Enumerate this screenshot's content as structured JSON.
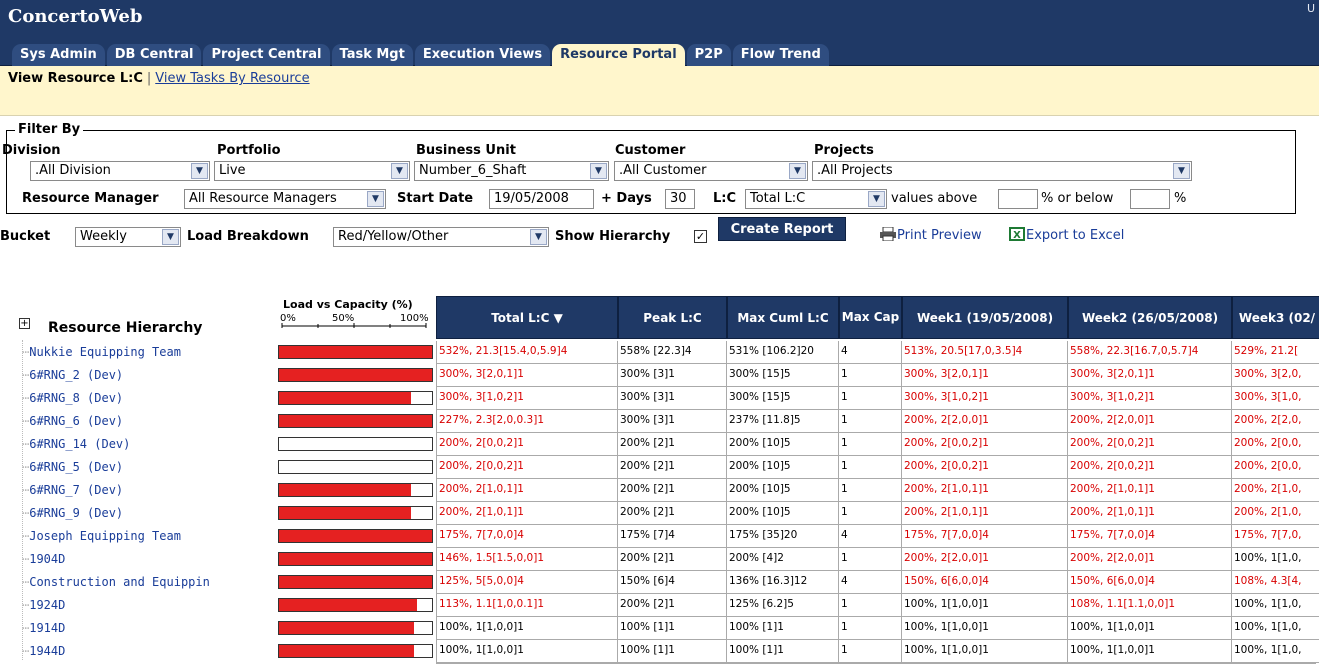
{
  "app": {
    "title": "ConcertoWeb",
    "user_mark": "U"
  },
  "tabs": [
    {
      "label": "Sys Admin",
      "active": false
    },
    {
      "label": "DB Central",
      "active": false
    },
    {
      "label": "Project Central",
      "active": false
    },
    {
      "label": "Task Mgt",
      "active": false
    },
    {
      "label": "Execution Views",
      "active": false
    },
    {
      "label": "Resource Portal",
      "active": true
    },
    {
      "label": "P2P",
      "active": false
    },
    {
      "label": "Flow Trend",
      "active": false
    }
  ],
  "subnav": {
    "current": "View Resource L:C",
    "separator": "|",
    "other": "View Tasks By Resource"
  },
  "filter": {
    "legend": "Filter By",
    "division_label": "Division",
    "division_value": ".All Division",
    "portfolio_label": "Portfolio",
    "portfolio_value": "Live",
    "business_unit_label": "Business Unit",
    "business_unit_value": "Number_6_Shaft",
    "customer_label": "Customer",
    "customer_value": ".All Customer",
    "projects_label": "Projects",
    "projects_value": ".All Projects",
    "resource_manager_label": "Resource Manager",
    "resource_manager_value": "All Resource Managers",
    "start_date_label": "Start Date",
    "start_date_value": "19/05/2008",
    "days_label": "+ Days",
    "days_value": "30",
    "lc_label": "L:C",
    "lc_value": "Total L:C",
    "values_above_label": "values above",
    "values_above_value": "",
    "or_below_label": "% or below",
    "or_below_value": "",
    "percent_suffix": "%"
  },
  "options": {
    "bucket_label": "Bucket",
    "bucket_value": "Weekly",
    "load_breakdown_label": "Load Breakdown",
    "load_breakdown_value": "Red/Yellow/Other",
    "show_hierarchy_label": "Show Hierarchy",
    "show_hierarchy_checked": true,
    "check_mark": "✓",
    "create_report": "Create Report",
    "print_preview": "Print Preview",
    "export_excel": "Export to Excel"
  },
  "grid": {
    "expand_symbol": "+",
    "hierarchy_title": "Resource Hierarchy",
    "lvc_title": "Load vs Capacity (%)",
    "lvc_ticks": [
      "0%",
      "50%",
      "100%"
    ],
    "columns": [
      "Total L:C ▼",
      "Peak L:C",
      "Max Cuml L:C",
      "Max Cap",
      "Week1 (19/05/2008)",
      "Week2 (26/05/2008)",
      "Week3 (02/"
    ],
    "rows": [
      {
        "name": "Nukkie Equipping Team",
        "load": 1.0,
        "cells": [
          "532%, 21.3[15.4,0,5.9]4",
          "558% [22.3]4",
          "531% [106.2]20",
          "4",
          "513%, 20.5[17,0,3.5]4",
          "558%, 22.3[16.7,0,5.7]4",
          "529%, 21.2["
        ],
        "red": [
          true,
          false,
          false,
          false,
          true,
          true,
          true
        ]
      },
      {
        "name": "6#RNG_2 (Dev)",
        "load": 1.0,
        "cells": [
          "300%, 3[2,0,1]1",
          "300% [3]1",
          "300% [15]5",
          "1",
          "300%, 3[2,0,1]1",
          "300%, 3[2,0,1]1",
          "300%, 3[2,0,"
        ],
        "red": [
          true,
          false,
          false,
          false,
          true,
          true,
          true
        ]
      },
      {
        "name": "6#RNG_8 (Dev)",
        "load": 0.86,
        "cells": [
          "300%, 3[1,0,2]1",
          "300% [3]1",
          "300% [15]5",
          "1",
          "300%, 3[1,0,2]1",
          "300%, 3[1,0,2]1",
          "300%, 3[1,0,"
        ],
        "red": [
          true,
          false,
          false,
          false,
          true,
          true,
          true
        ]
      },
      {
        "name": "6#RNG_6 (Dev)",
        "load": 1.0,
        "cells": [
          "227%, 2.3[2,0,0.3]1",
          "300% [3]1",
          "237% [11.8]5",
          "1",
          "200%, 2[2,0,0]1",
          "200%, 2[2,0,0]1",
          "200%, 2[2,0,"
        ],
        "red": [
          true,
          false,
          false,
          false,
          true,
          true,
          true
        ]
      },
      {
        "name": "6#RNG_14 (Dev)",
        "load": 0.0,
        "cells": [
          "200%, 2[0,0,2]1",
          "200% [2]1",
          "200% [10]5",
          "1",
          "200%, 2[0,0,2]1",
          "200%, 2[0,0,2]1",
          "200%, 2[0,0,"
        ],
        "red": [
          true,
          false,
          false,
          false,
          true,
          true,
          true
        ]
      },
      {
        "name": "6#RNG_5 (Dev)",
        "load": 0.0,
        "cells": [
          "200%, 2[0,0,2]1",
          "200% [2]1",
          "200% [10]5",
          "1",
          "200%, 2[0,0,2]1",
          "200%, 2[0,0,2]1",
          "200%, 2[0,0,"
        ],
        "red": [
          true,
          false,
          false,
          false,
          true,
          true,
          true
        ]
      },
      {
        "name": "6#RNG_7 (Dev)",
        "load": 0.86,
        "cells": [
          "200%, 2[1,0,1]1",
          "200% [2]1",
          "200% [10]5",
          "1",
          "200%, 2[1,0,1]1",
          "200%, 2[1,0,1]1",
          "200%, 2[1,0,"
        ],
        "red": [
          true,
          false,
          false,
          false,
          true,
          true,
          true
        ]
      },
      {
        "name": "6#RNG_9 (Dev)",
        "load": 0.86,
        "cells": [
          "200%, 2[1,0,1]1",
          "200% [2]1",
          "200% [10]5",
          "1",
          "200%, 2[1,0,1]1",
          "200%, 2[1,0,1]1",
          "200%, 2[1,0,"
        ],
        "red": [
          true,
          false,
          false,
          false,
          true,
          true,
          true
        ]
      },
      {
        "name": "Joseph Equipping Team",
        "load": 1.0,
        "cells": [
          "175%, 7[7,0,0]4",
          "175% [7]4",
          "175% [35]20",
          "4",
          "175%, 7[7,0,0]4",
          "175%, 7[7,0,0]4",
          "175%, 7[7,0,"
        ],
        "red": [
          true,
          false,
          false,
          false,
          true,
          true,
          true
        ]
      },
      {
        "name": "1904D",
        "load": 1.0,
        "cells": [
          "146%, 1.5[1.5,0,0]1",
          "200% [2]1",
          "200% [4]2",
          "1",
          "200%, 2[2,0,0]1",
          "200%, 2[2,0,0]1",
          "100%, 1[1,0,"
        ],
        "red": [
          true,
          false,
          false,
          false,
          true,
          true,
          false
        ]
      },
      {
        "name": "Construction and Equippin",
        "load": 1.0,
        "cells": [
          "125%, 5[5,0,0]4",
          "150% [6]4",
          "136% [16.3]12",
          "4",
          "150%, 6[6,0,0]4",
          "150%, 6[6,0,0]4",
          "108%, 4.3[4,"
        ],
        "red": [
          true,
          false,
          false,
          false,
          true,
          true,
          true
        ]
      },
      {
        "name": "1924D",
        "load": 0.9,
        "cells": [
          "113%, 1.1[1,0,0.1]1",
          "200% [2]1",
          "125% [6.2]5",
          "1",
          "100%, 1[1,0,0]1",
          "108%, 1.1[1.1,0,0]1",
          "100%, 1[1,0,"
        ],
        "red": [
          true,
          false,
          false,
          false,
          false,
          true,
          false
        ]
      },
      {
        "name": "1914D",
        "load": 0.88,
        "cells": [
          "100%, 1[1,0,0]1",
          "100% [1]1",
          "100% [1]1",
          "1",
          "100%, 1[1,0,0]1",
          "100%, 1[1,0,0]1",
          "100%, 1[1,0,"
        ],
        "red": [
          false,
          false,
          false,
          false,
          false,
          false,
          false
        ]
      },
      {
        "name": "1944D",
        "load": 0.88,
        "cells": [
          "100%, 1[1,0,0]1",
          "100% [1]1",
          "100% [1]1",
          "1",
          "100%, 1[1,0,0]1",
          "100%, 1[1,0,0]1",
          "100%, 1[1,0,"
        ],
        "red": [
          false,
          false,
          false,
          false,
          false,
          false,
          false
        ]
      }
    ]
  },
  "colors": {
    "nav": "#1f3966",
    "tab_active": "#fff6cc",
    "bar": "#e52121",
    "overload_text": "#d80000"
  }
}
